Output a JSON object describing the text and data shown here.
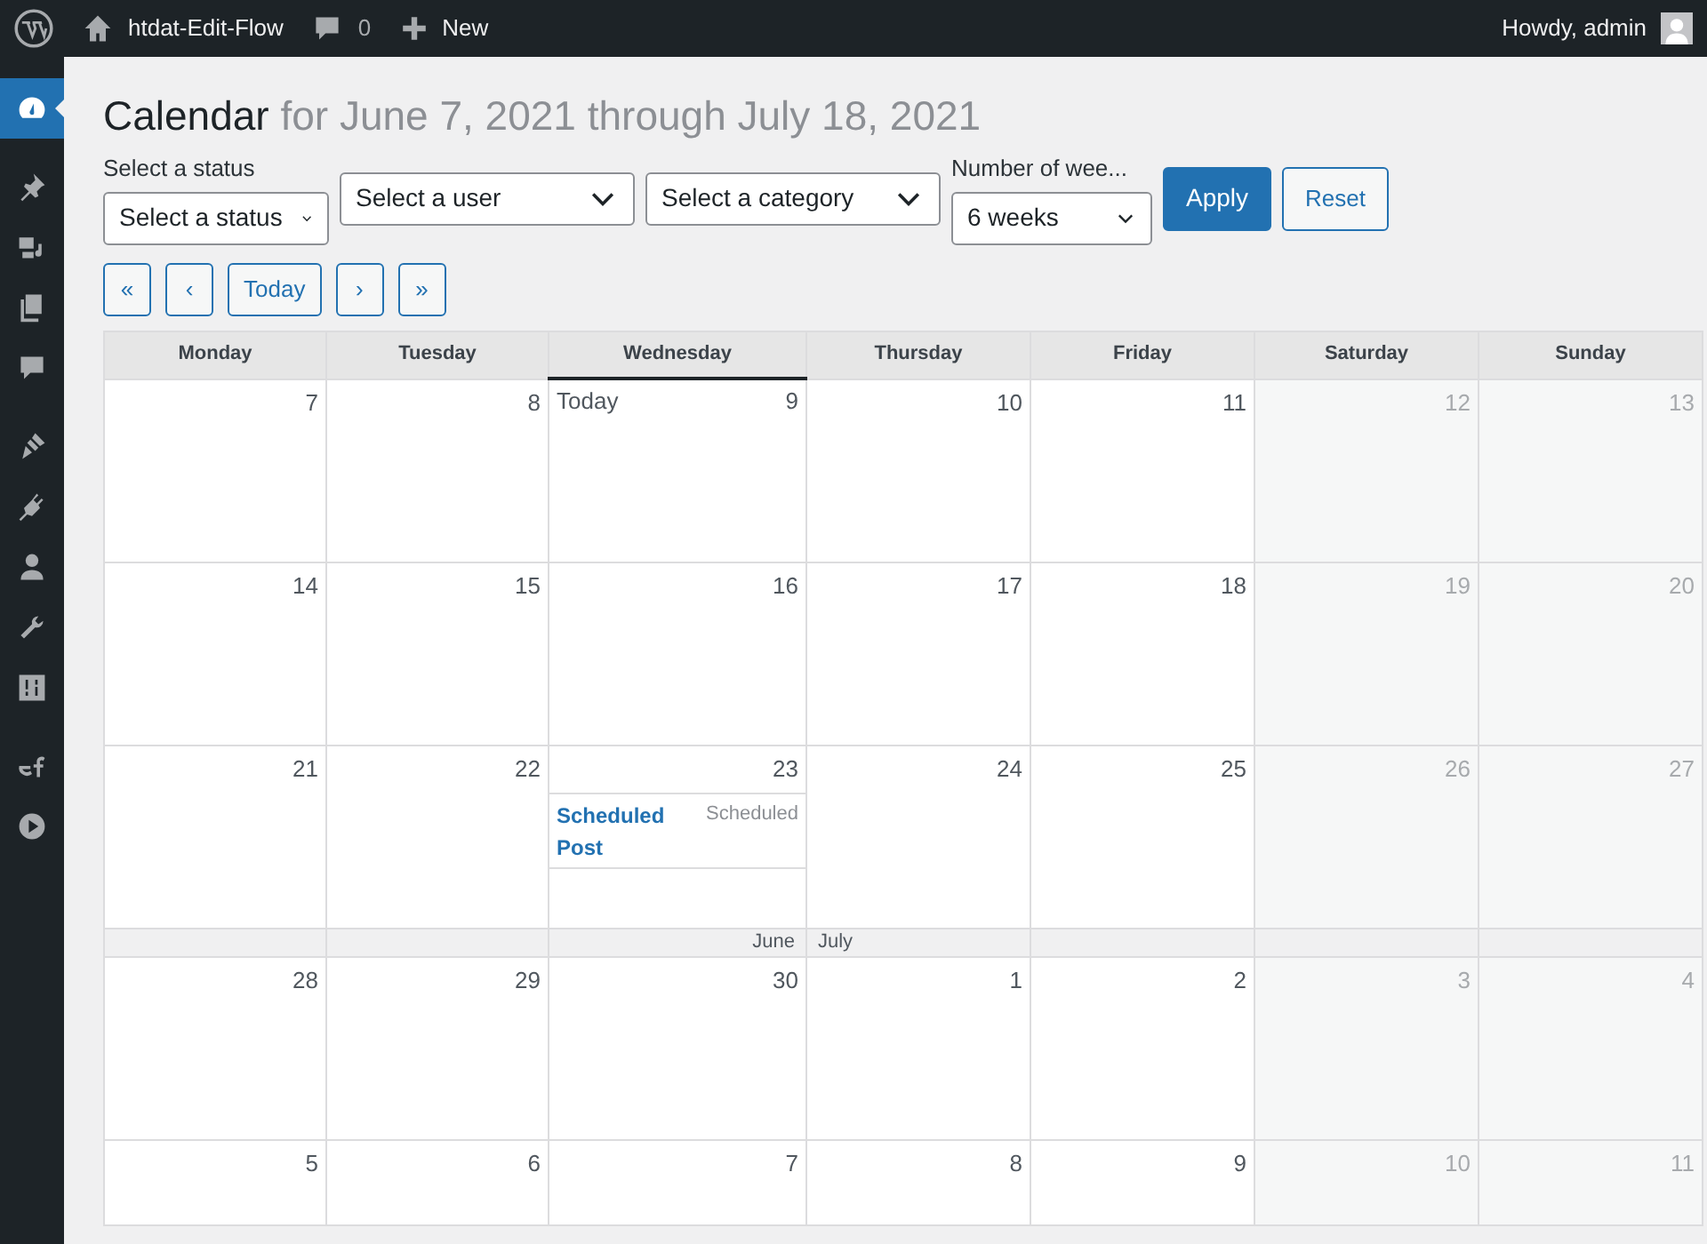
{
  "admin_bar": {
    "site_name": "htdat-Edit-Flow",
    "comments_count": "0",
    "new_label": "New",
    "greeting": "Howdy, admin"
  },
  "sidebar": {
    "items": [
      {
        "kind": "dashboard",
        "selected": true
      },
      {
        "kind": "pin",
        "selected": false
      },
      {
        "kind": "media",
        "selected": false
      },
      {
        "kind": "pages",
        "selected": false
      },
      {
        "kind": "comments",
        "selected": false
      },
      {
        "kind": "brush",
        "selected": false
      },
      {
        "kind": "plugin",
        "selected": false
      },
      {
        "kind": "user",
        "selected": false
      },
      {
        "kind": "wrench",
        "selected": false
      },
      {
        "kind": "sliders",
        "selected": false
      },
      {
        "kind": "ef",
        "selected": false
      },
      {
        "kind": "play",
        "selected": false
      }
    ]
  },
  "heading": {
    "title": "Calendar",
    "subtitle": "for June 7, 2021 through July 18, 2021"
  },
  "filters": [
    {
      "label": "Select a status",
      "value": "Select a status"
    },
    {
      "value": "Select a user"
    },
    {
      "value": "Select a category"
    },
    {
      "label": "Number of wee...",
      "value": "6 weeks"
    }
  ],
  "buttons": [
    {
      "label": "Apply",
      "kind": "primary"
    },
    {
      "label": "Reset",
      "kind": "secondary"
    }
  ],
  "navigation": [
    "«",
    "‹",
    "Today",
    "›",
    "»"
  ],
  "calendar": {
    "columns": [
      {
        "label": "Monday",
        "weekend": false
      },
      {
        "label": "Tuesday",
        "weekend": false
      },
      {
        "label": "Wednesday",
        "weekend": false
      },
      {
        "label": "Thursday",
        "weekend": false
      },
      {
        "label": "Friday",
        "weekend": false
      },
      {
        "label": "Saturday",
        "weekend": true
      },
      {
        "label": "Sunday",
        "weekend": true
      }
    ],
    "rows": [
      {
        "kind": "week",
        "days": [
          {
            "day": "7"
          },
          {
            "day": "8"
          },
          {
            "day": "9",
            "today": true,
            "today_label": "Today"
          },
          {
            "day": "10"
          },
          {
            "day": "11"
          },
          {
            "day": "12"
          },
          {
            "day": "13"
          }
        ]
      },
      {
        "kind": "week",
        "days": [
          {
            "day": "14"
          },
          {
            "day": "15"
          },
          {
            "day": "16"
          },
          {
            "day": "17"
          },
          {
            "day": "18"
          },
          {
            "day": "19"
          },
          {
            "day": "20"
          }
        ]
      },
      {
        "kind": "week",
        "days": [
          {
            "day": "21"
          },
          {
            "day": "22"
          },
          {
            "day": "23",
            "posts": [
              {
                "title": "Scheduled Post",
                "status": "Scheduled"
              }
            ]
          },
          {
            "day": "24"
          },
          {
            "day": "25"
          },
          {
            "day": "26"
          },
          {
            "day": "27"
          }
        ]
      },
      {
        "kind": "month_break",
        "previous": "June",
        "next": "July"
      },
      {
        "kind": "week",
        "days": [
          {
            "day": "28"
          },
          {
            "day": "29"
          },
          {
            "day": "30"
          },
          {
            "day": "1",
            "month_start": true
          },
          {
            "day": "2"
          },
          {
            "day": "3"
          },
          {
            "day": "4"
          }
        ]
      },
      {
        "kind": "week",
        "days": [
          {
            "day": "5"
          },
          {
            "day": "6"
          },
          {
            "day": "7"
          },
          {
            "day": "8"
          },
          {
            "day": "9"
          },
          {
            "day": "10"
          },
          {
            "day": "11"
          }
        ]
      }
    ]
  }
}
